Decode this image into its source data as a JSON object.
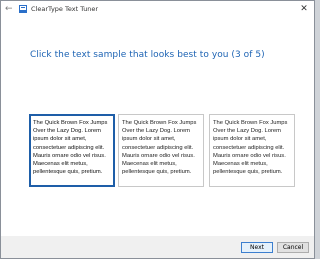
{
  "window": {
    "title": "ClearType Text Tuner"
  },
  "icons": {
    "back": "back-arrow-icon",
    "app": "cleartype-app-icon",
    "close": "close-icon"
  },
  "glyphs": {
    "back": "←",
    "close": "✕"
  },
  "heading": "Click the text sample that looks best to you (3 of 5)",
  "samples": [
    {
      "text": "The Quick Brown Fox Jumps Over the Lazy Dog. Lorem ipsum dolor sit amet, consectetuer adipiscing elit. Mauris ornare odio vel risus. Maecenas elit metus, pellentesque quis, pretium.",
      "selected": true
    },
    {
      "text": "The Quick Brown Fox Jumps Over the Lazy Dog. Lorem ipsum dolor sit amet, consectetuer adipiscing elit. Mauris ornare odio vel risus. Maecenas elit metus, pellentesque quis, pretium.",
      "selected": false
    },
    {
      "text": "The Quick Brown Fox Jumps Over the Lazy Dog. Lorem ipsum dolor sit amet, consectetuer adipiscing elit. Mauris ornare odio vel risus. Maecenas elit metus, pellentesque quis, pretium.",
      "selected": false
    }
  ],
  "buttons": {
    "next": "Next",
    "cancel": "Cancel"
  },
  "colors": {
    "accent": "#1e64b4",
    "selected_border": "#1e5ea8"
  }
}
